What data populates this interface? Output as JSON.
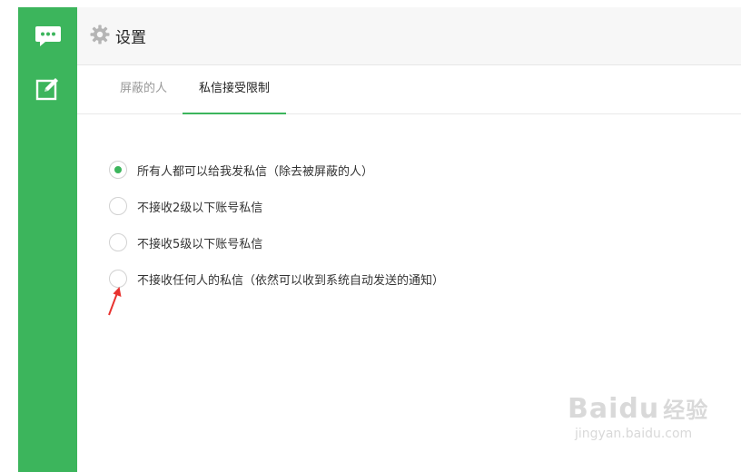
{
  "header": {
    "title": "设置",
    "icon": "gear-icon"
  },
  "sidebar": {
    "color": "#3cb55c",
    "items": [
      {
        "icon": "chat-bubble-icon",
        "active": true
      },
      {
        "icon": "edit-icon",
        "active": false
      }
    ]
  },
  "tabs": [
    {
      "label": "屏蔽的人",
      "active": false
    },
    {
      "label": "私信接受限制",
      "active": true
    }
  ],
  "options": [
    {
      "label": "所有人都可以给我发私信（除去被屏蔽的人）",
      "checked": true
    },
    {
      "label": "不接收2级以下账号私信",
      "checked": false
    },
    {
      "label": "不接收5级以下账号私信",
      "checked": false
    },
    {
      "label": "不接收任何人的私信（依然可以收到系统自动发送的通知）",
      "checked": false
    }
  ],
  "watermark": {
    "logo": "Baidu",
    "logo_suffix": "经验",
    "url": "jingyan.baidu.com"
  },
  "colors": {
    "accent": "#3cb55c",
    "annotation_arrow": "#e8322f"
  }
}
